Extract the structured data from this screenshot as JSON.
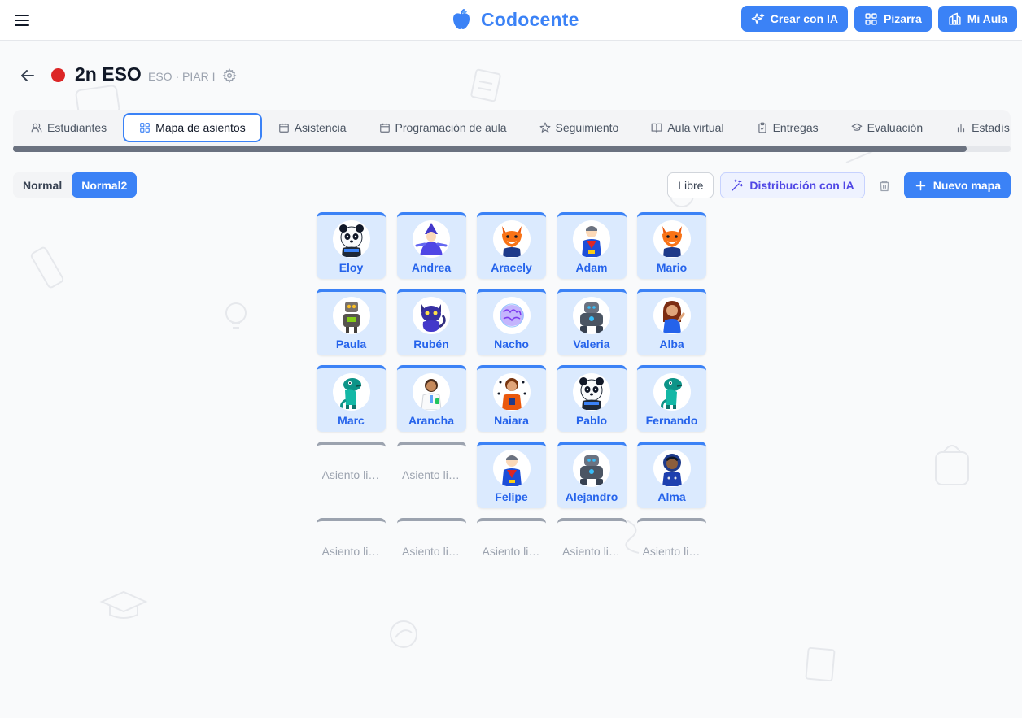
{
  "app": {
    "brand_name": "Codocente",
    "brand_icon": "apple-icon",
    "actions": [
      {
        "label": "Crear con IA",
        "icon": "sparkles-icon"
      },
      {
        "label": "Pizarra",
        "icon": "grid-icon"
      },
      {
        "label": "Mi Aula",
        "icon": "school-icon"
      }
    ]
  },
  "class_header": {
    "title": "2n ESO",
    "meta": "ESO · PIAR I",
    "dot_color": "#dc2626"
  },
  "tabs": [
    {
      "label": "Estudiantes",
      "icon": "users-icon"
    },
    {
      "label": "Mapa de asientos",
      "icon": "grid-icon",
      "active": true
    },
    {
      "label": "Asistencia",
      "icon": "calendar-icon"
    },
    {
      "label": "Programación de aula",
      "icon": "calendar-icon"
    },
    {
      "label": "Seguimiento",
      "icon": "star-icon"
    },
    {
      "label": "Aula virtual",
      "icon": "book-open-icon"
    },
    {
      "label": "Entregas",
      "icon": "clipboard-check-icon"
    },
    {
      "label": "Evaluación",
      "icon": "graduation-cap-icon"
    },
    {
      "label": "Estadís",
      "icon": "bar-chart-icon"
    }
  ],
  "toolbar": {
    "maps": [
      {
        "label": "Normal",
        "active": false
      },
      {
        "label": "Normal2",
        "active": true
      }
    ],
    "libre_label": "Libre",
    "ai_label": "Distribución con IA",
    "new_map_label": "Nuevo mapa"
  },
  "seats": [
    {
      "name": "Eloy",
      "avatar": "panda"
    },
    {
      "name": "Andrea",
      "avatar": "wizard"
    },
    {
      "name": "Aracely",
      "avatar": "fox"
    },
    {
      "name": "Adam",
      "avatar": "hero"
    },
    {
      "name": "Mario",
      "avatar": "fox"
    },
    {
      "name": "Paula",
      "avatar": "robot"
    },
    {
      "name": "Rubén",
      "avatar": "cat"
    },
    {
      "name": "Nacho",
      "avatar": "brain"
    },
    {
      "name": "Valeria",
      "avatar": "golem"
    },
    {
      "name": "Alba",
      "avatar": "girl"
    },
    {
      "name": "Marc",
      "avatar": "dino"
    },
    {
      "name": "Arancha",
      "avatar": "scientist"
    },
    {
      "name": "Naiara",
      "avatar": "kid"
    },
    {
      "name": "Pablo",
      "avatar": "panda"
    },
    {
      "name": "Fernando",
      "avatar": "dino"
    },
    {
      "empty": true,
      "label": "Asiento libre"
    },
    {
      "empty": true,
      "label": "Asiento libre"
    },
    {
      "name": "Felipe",
      "avatar": "hero"
    },
    {
      "name": "Alejandro",
      "avatar": "golem"
    },
    {
      "name": "Alma",
      "avatar": "astronaut"
    },
    {
      "empty": true,
      "label": "Asiento libre"
    },
    {
      "empty": true,
      "label": "Asiento libre"
    },
    {
      "empty": true,
      "label": "Asiento libre"
    },
    {
      "empty": true,
      "label": "Asiento libre"
    },
    {
      "empty": true,
      "label": "Asiento libre"
    }
  ],
  "colors": {
    "accent": "#3b82f6",
    "seat_bg": "#dbeafe",
    "seat_name": "#2563eb",
    "ai_button": "#4f46e5"
  }
}
